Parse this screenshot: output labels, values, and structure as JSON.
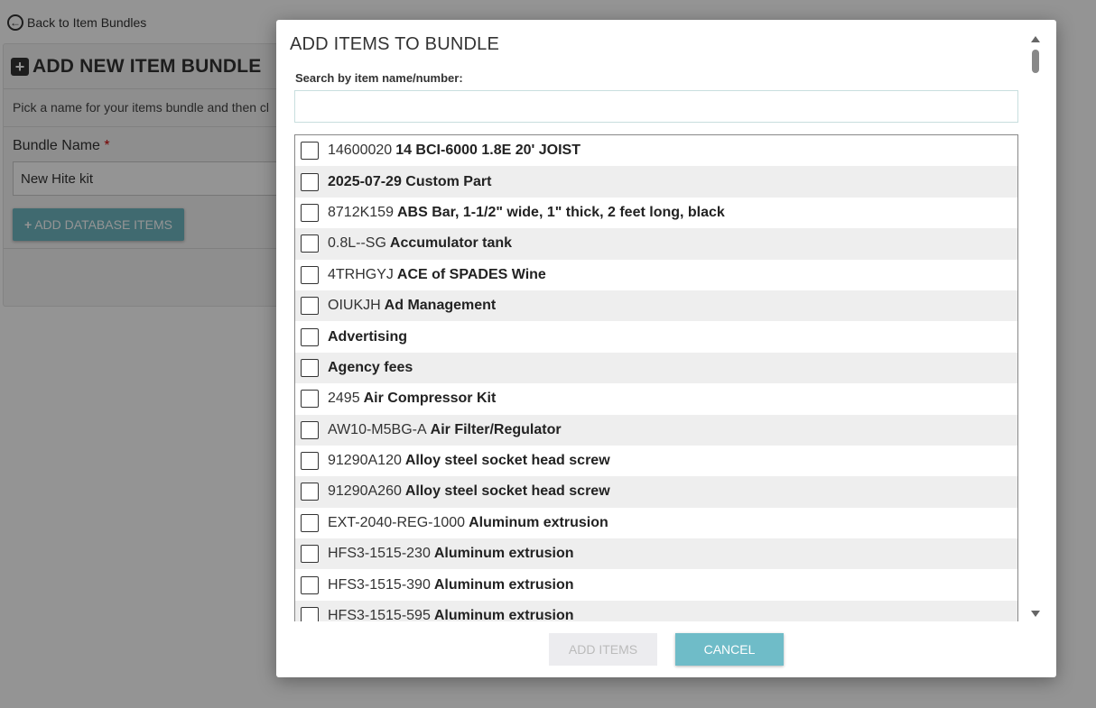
{
  "background": {
    "back_link": "Back to Item Bundles",
    "panel_title": "ADD NEW ITEM BUNDLE",
    "panel_description": "Pick a name for your items bundle and then cl",
    "bundle_name_label": "Bundle Name",
    "required_mark": "*",
    "bundle_name_value": "New Hite kit",
    "add_db_items_label": "ADD DATABASE ITEMS"
  },
  "modal": {
    "title": "ADD ITEMS TO BUNDLE",
    "search_label": "Search by item name/number:",
    "search_value": "",
    "items": [
      {
        "number": "14600020",
        "name": "14 BCI-6000 1.8E 20' JOIST"
      },
      {
        "number": "",
        "name": "2025-07-29 Custom Part"
      },
      {
        "number": "8712K159",
        "name": "ABS Bar, 1-1/2\" wide, 1\" thick, 2 feet long, black"
      },
      {
        "number": "0.8L--SG",
        "name": "Accumulator tank"
      },
      {
        "number": "4TRHGYJ",
        "name": "ACE of SPADES Wine"
      },
      {
        "number": "OIUKJH",
        "name": "Ad Management"
      },
      {
        "number": "",
        "name": "Advertising"
      },
      {
        "number": "",
        "name": "Agency fees"
      },
      {
        "number": "2495",
        "name": "Air Compressor Kit"
      },
      {
        "number": "AW10-M5BG-A",
        "name": "Air Filter/Regulator"
      },
      {
        "number": "91290A120",
        "name": "Alloy steel socket head screw"
      },
      {
        "number": "91290A260",
        "name": "Alloy steel socket head screw"
      },
      {
        "number": "EXT-2040-REG-1000",
        "name": "Aluminum extrusion"
      },
      {
        "number": "HFS3-1515-230",
        "name": "Aluminum extrusion"
      },
      {
        "number": "HFS3-1515-390",
        "name": "Aluminum extrusion"
      },
      {
        "number": "HFS3-1515-595",
        "name": "Aluminum extrusion"
      }
    ],
    "add_items_label": "ADD ITEMS",
    "cancel_label": "CANCEL"
  },
  "colors": {
    "accent": "#6fbcc8",
    "overlay": "#000000"
  }
}
